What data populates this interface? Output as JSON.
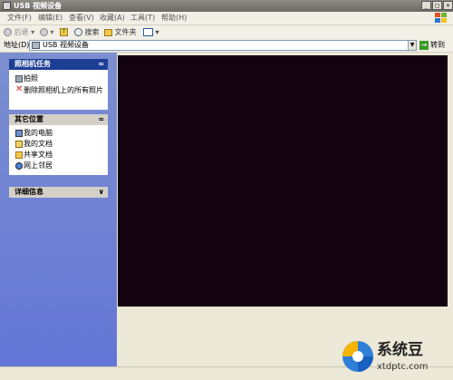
{
  "window": {
    "title": "USB 视频设备"
  },
  "menubar": {
    "items": [
      {
        "label": "文件(F)"
      },
      {
        "label": "编辑(E)"
      },
      {
        "label": "查看(V)"
      },
      {
        "label": "收藏(A)"
      },
      {
        "label": "工具(T)"
      },
      {
        "label": "帮助(H)"
      }
    ]
  },
  "toolbar": {
    "back_label": "后退",
    "search_label": "搜索",
    "folders_label": "文件夹"
  },
  "address": {
    "label": "地址(D)",
    "value": "USB 视频设备",
    "go_label": "转到"
  },
  "camera_tasks": {
    "title": "照相机任务",
    "items": [
      {
        "label": "拍照",
        "icon": "camera-icon"
      },
      {
        "label": "删除照相机上的所有照片",
        "icon": "delete-x-icon"
      }
    ]
  },
  "other_places": {
    "title": "其它位置",
    "items": [
      {
        "label": "我的电脑",
        "icon": "my-computer-icon"
      },
      {
        "label": "我的文档",
        "icon": "my-documents-icon"
      },
      {
        "label": "共享文档",
        "icon": "shared-documents-icon"
      },
      {
        "label": "网上邻居",
        "icon": "network-places-icon"
      }
    ]
  },
  "details": {
    "title": "详细信息"
  },
  "watermark": {
    "name": "系统豆",
    "url": "xtdptc.com"
  },
  "colors": {
    "preview_bg": "#150211",
    "panel_body": "#d6dff7",
    "header_dark": "#1c3f95",
    "header_light": "#d4d0c8"
  }
}
